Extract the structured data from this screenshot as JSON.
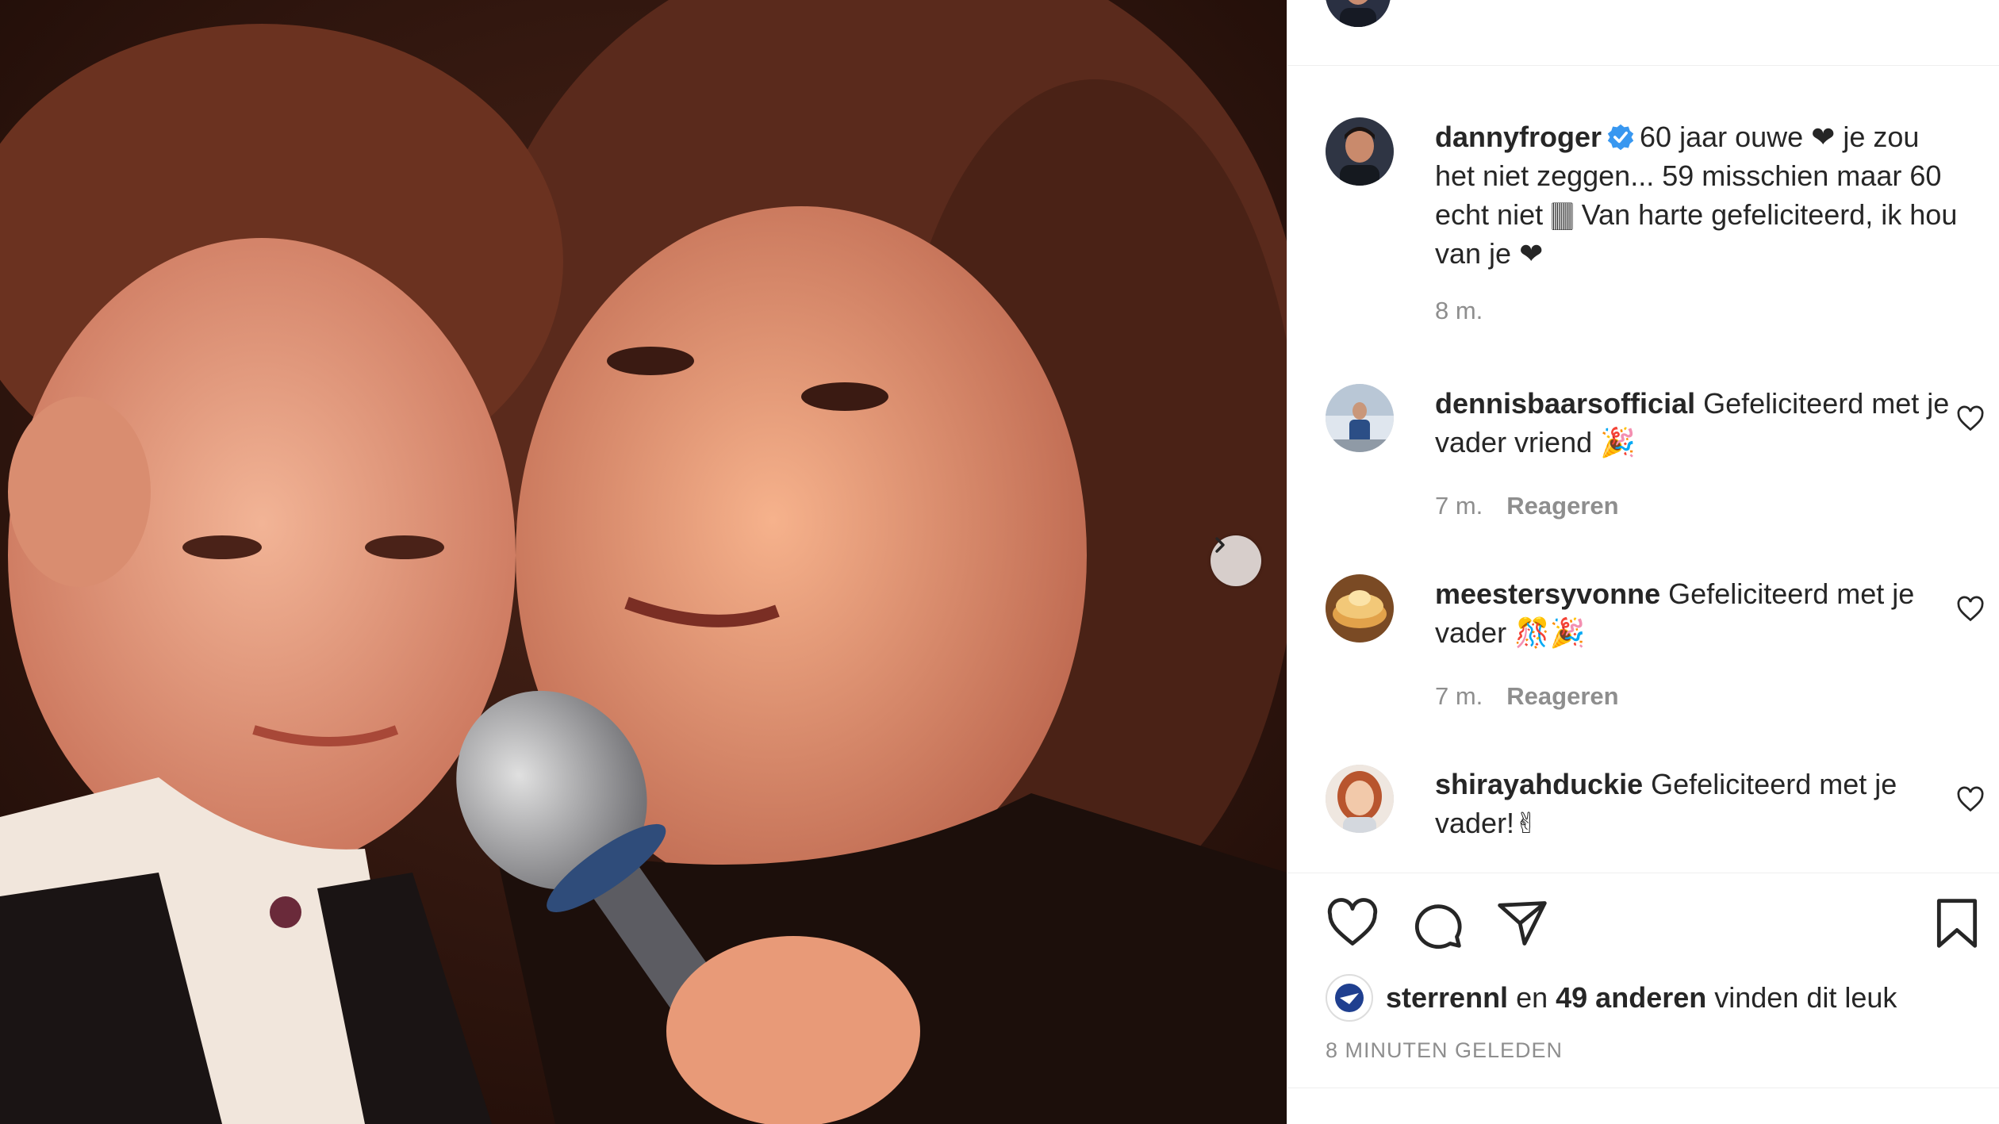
{
  "post": {
    "photo_alt": "",
    "colors": {
      "text": "#262626",
      "muted": "#8e8e8e",
      "verified": "#3897f0",
      "divider": "#efefef"
    }
  },
  "caption": {
    "username": "dannyfroger",
    "verified_icon": "verified-badge-icon",
    "text": "60 jaar ouwe ❤ je zou het niet zeggen... 59 misschien maar 60 echt niet 🀫 Van harte gefeliciteerd, ik hou van je ❤",
    "time": "8 m."
  },
  "comments": [
    {
      "username": "dennisbaarsofficial",
      "text": "Gefeliciteerd met je vader vriend 🎉",
      "time": "7 m.",
      "reply": "Reageren"
    },
    {
      "username": "meestersyvonne",
      "text": "Gefeliciteerd met je vader 🎊🎉",
      "time": "7 m.",
      "reply": "Reageren"
    },
    {
      "username": "shirayahduckie",
      "text": "Gefeliciteerd met je vader!✌",
      "time": "",
      "reply": ""
    }
  ],
  "likes": {
    "first_liker": "sterrennl",
    "connector": "en",
    "others": "49 anderen",
    "suffix": "vinden dit leuk"
  },
  "posted": "8 MINUTEN GELEDEN",
  "icons": [
    "heart-icon",
    "comment-icon",
    "share-icon",
    "bookmark-icon",
    "chevron-right-icon"
  ]
}
